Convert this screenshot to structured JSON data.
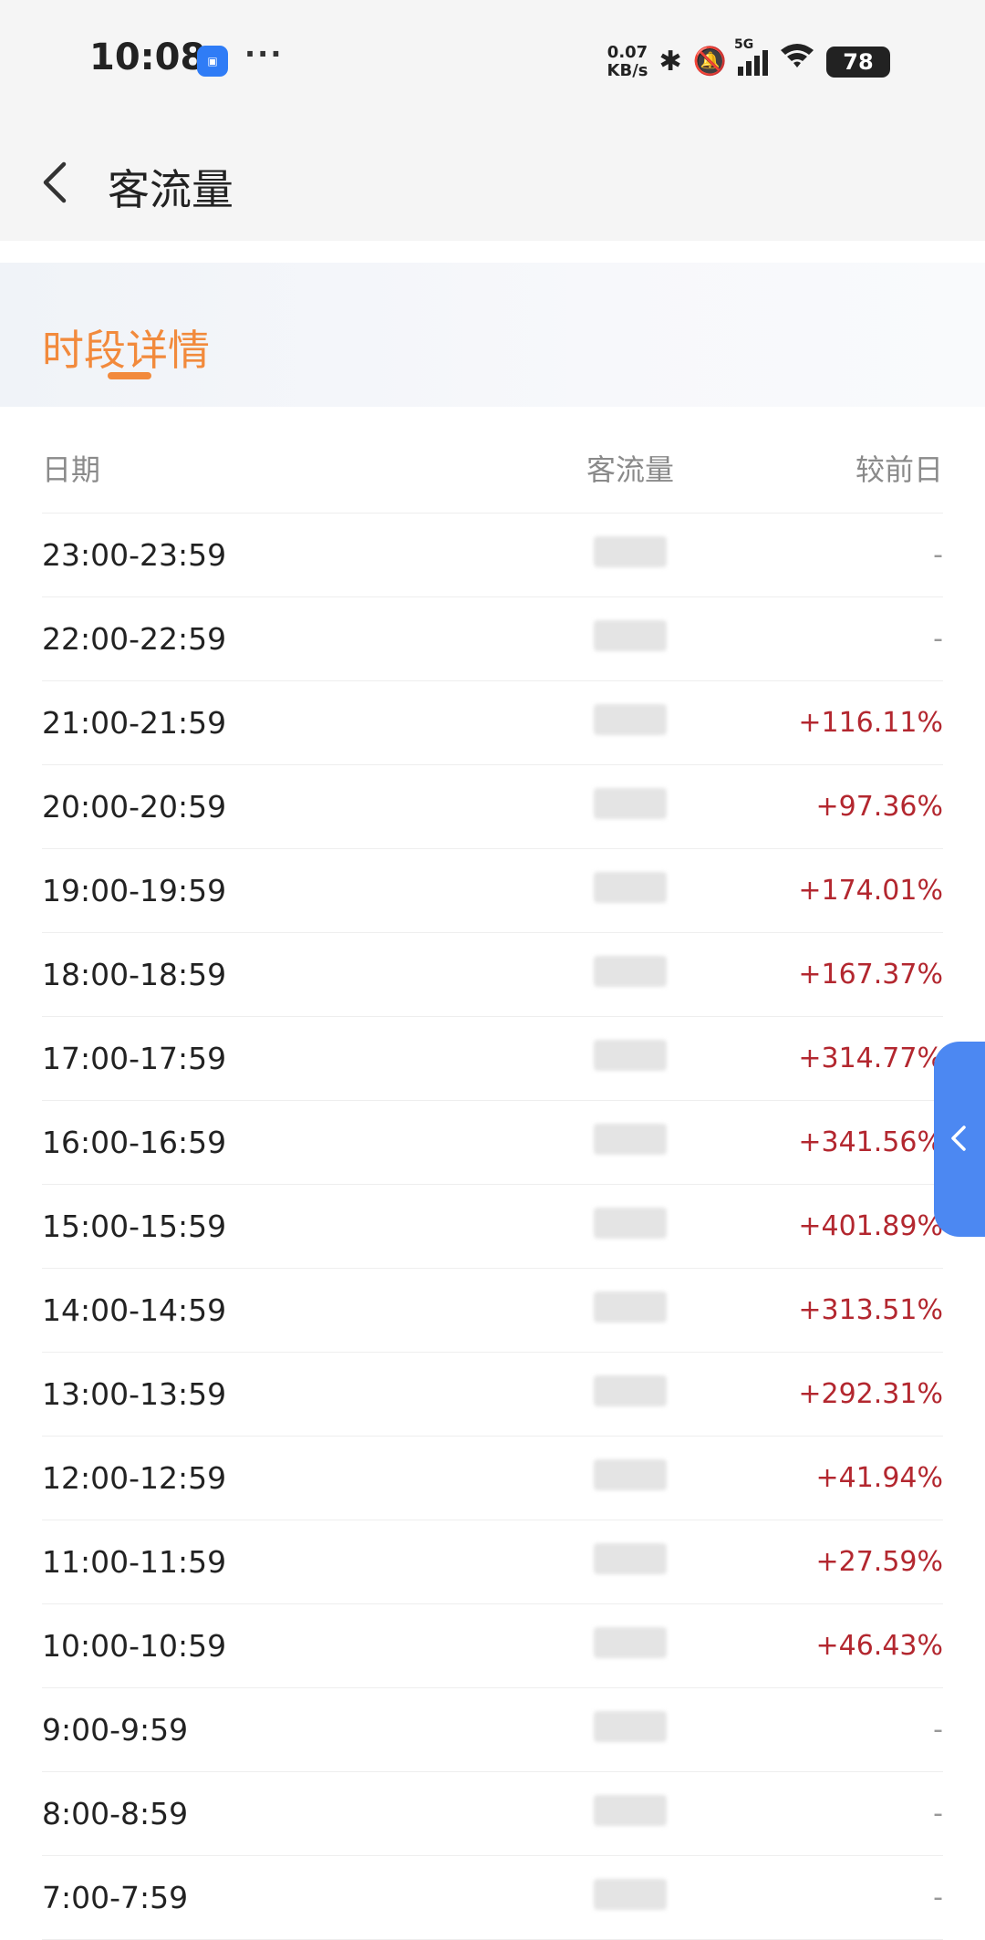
{
  "status_bar": {
    "time": "10:08",
    "more_indicator": "···",
    "net_speed_value": "0.07",
    "net_speed_unit": "KB/s",
    "network_type": "5G",
    "battery": "78",
    "icons": [
      "app-notification-icon",
      "bluetooth-icon",
      "mute-icon",
      "signal-icon",
      "wifi-icon",
      "battery-icon"
    ]
  },
  "header": {
    "title": "客流量",
    "back_icon": "chevron-left-icon"
  },
  "tabs": {
    "active": "时段详情"
  },
  "table": {
    "columns": [
      "日期",
      "客流量",
      "较前日"
    ],
    "rows": [
      {
        "period": "23:00-23:59",
        "change": "-"
      },
      {
        "period": "22:00-22:59",
        "change": "-"
      },
      {
        "period": "21:00-21:59",
        "change": "+116.11%"
      },
      {
        "period": "20:00-20:59",
        "change": "+97.36%"
      },
      {
        "period": "19:00-19:59",
        "change": "+174.01%"
      },
      {
        "period": "18:00-18:59",
        "change": "+167.37%"
      },
      {
        "period": "17:00-17:59",
        "change": "+314.77%"
      },
      {
        "period": "16:00-16:59",
        "change": "+341.56%"
      },
      {
        "period": "15:00-15:59",
        "change": "+401.89%"
      },
      {
        "period": "14:00-14:59",
        "change": "+313.51%"
      },
      {
        "period": "13:00-13:59",
        "change": "+292.31%"
      },
      {
        "period": "12:00-12:59",
        "change": "+41.94%"
      },
      {
        "period": "11:00-11:59",
        "change": "+27.59%"
      },
      {
        "period": "10:00-10:59",
        "change": "+46.43%"
      },
      {
        "period": "9:00-9:59",
        "change": "-"
      },
      {
        "period": "8:00-8:59",
        "change": "-"
      },
      {
        "period": "7:00-7:59",
        "change": "-"
      }
    ]
  },
  "side_handle": {
    "icon": "chevron-left-icon"
  },
  "colors": {
    "accent": "#f28a3c",
    "positive_change": "#b3272f",
    "side_handle": "#4c88f2"
  }
}
